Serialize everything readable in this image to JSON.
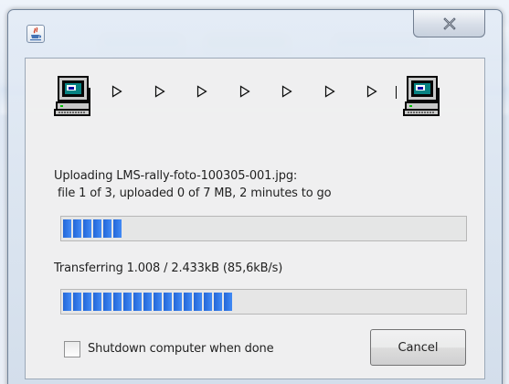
{
  "window": {
    "close_glyph": "X"
  },
  "transfer": {
    "status_line1": "Uploading LMS-rally-foto-100305-001.jpg:",
    "status_line2": "file 1 of 3, uploaded 0 of 7 MB, 2 minutes to go",
    "overall_progress_percent": 13,
    "transfer_line": "Transferring 1.008 / 2.433kB (85,6kB/s)",
    "file_progress_percent": 41
  },
  "controls": {
    "shutdown_label": "Shutdown computer when done",
    "shutdown_checked": false,
    "cancel_label": "Cancel"
  },
  "icons": {
    "title": "java-cup-icon",
    "source": "computer-icon",
    "destination": "computer-icon",
    "arrows": "play-arrow-icon"
  },
  "colors": {
    "progress_fill": "#2f78ea",
    "window_frame": "#d3deeb",
    "client_bg": "#f0f0f0"
  }
}
